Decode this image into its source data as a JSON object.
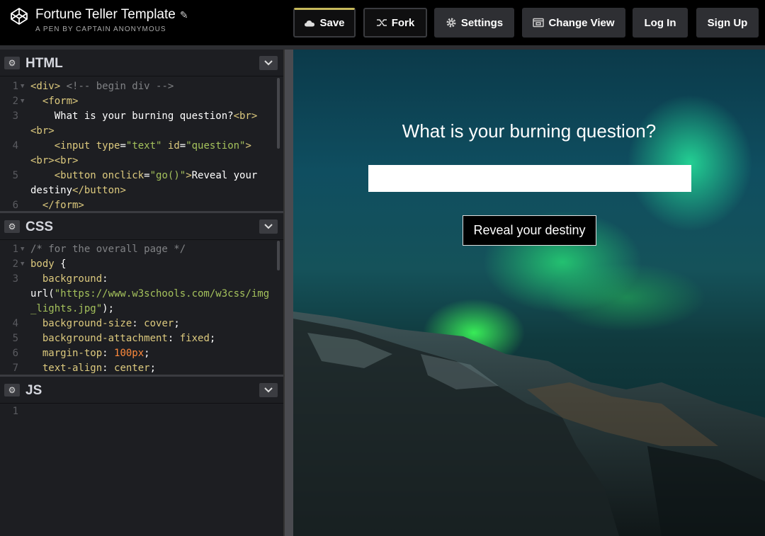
{
  "header": {
    "title": "Fortune Teller Template",
    "author": "A PEN BY CAPTAIN ANONYMOUS",
    "buttons": {
      "save": "Save",
      "fork": "Fork",
      "settings": "Settings",
      "change_view": "Change View",
      "login": "Log In",
      "signup": "Sign Up"
    },
    "accent": "#c6b85a"
  },
  "panels": {
    "html": {
      "title": "HTML"
    },
    "css": {
      "title": "CSS"
    },
    "js": {
      "title": "JS"
    }
  },
  "html_code": [
    {
      "n": "1",
      "fold": true,
      "parts": [
        [
          "t-tag",
          "<div>"
        ],
        [
          "t-cmt",
          " <!-- begin div -->"
        ]
      ]
    },
    {
      "n": "2",
      "fold": true,
      "parts": [
        [
          "t-txt",
          "  "
        ],
        [
          "t-tag",
          "<form>"
        ]
      ]
    },
    {
      "n": "3",
      "fold": false,
      "parts": [
        [
          "t-txt",
          "    What is your burning question?"
        ],
        [
          "t-tag",
          "<br>"
        ]
      ]
    },
    {
      "n": "",
      "fold": false,
      "parts": [
        [
          "t-tag",
          "<br>"
        ]
      ]
    },
    {
      "n": "4",
      "fold": false,
      "parts": [
        [
          "t-txt",
          "    "
        ],
        [
          "t-tag",
          "<input "
        ],
        [
          "t-attr",
          "type"
        ],
        [
          "t-txt",
          "="
        ],
        [
          "t-str",
          "\"text\""
        ],
        [
          "t-txt",
          " "
        ],
        [
          "t-attr",
          "id"
        ],
        [
          "t-txt",
          "="
        ],
        [
          "t-str",
          "\"question\""
        ],
        [
          "t-tag",
          ">"
        ]
      ]
    },
    {
      "n": "",
      "fold": false,
      "parts": [
        [
          "t-tag",
          "<br><br>"
        ]
      ]
    },
    {
      "n": "5",
      "fold": false,
      "parts": [
        [
          "t-txt",
          "    "
        ],
        [
          "t-tag",
          "<button "
        ],
        [
          "t-attr",
          "onclick"
        ],
        [
          "t-txt",
          "="
        ],
        [
          "t-str",
          "\"go()\""
        ],
        [
          "t-tag",
          ">"
        ],
        [
          "t-txt",
          "Reveal your"
        ]
      ]
    },
    {
      "n": "",
      "fold": false,
      "parts": [
        [
          "t-txt",
          "destiny"
        ],
        [
          "t-tag",
          "</button>"
        ]
      ]
    },
    {
      "n": "6",
      "fold": false,
      "parts": [
        [
          "t-txt",
          "  "
        ],
        [
          "t-tag",
          "</form>"
        ]
      ]
    }
  ],
  "css_code": [
    {
      "n": "1",
      "fold": true,
      "parts": [
        [
          "t-cmt",
          "/* for the overall page */"
        ]
      ]
    },
    {
      "n": "2",
      "fold": true,
      "parts": [
        [
          "t-tag",
          "body"
        ],
        [
          "t-txt",
          " {"
        ]
      ]
    },
    {
      "n": "3",
      "fold": false,
      "parts": [
        [
          "t-txt",
          "  "
        ],
        [
          "t-prop",
          "background"
        ],
        [
          "t-txt",
          ":"
        ]
      ]
    },
    {
      "n": "",
      "fold": false,
      "parts": [
        [
          "t-txt",
          "url("
        ],
        [
          "t-str",
          "\"https://www.w3schools.com/w3css/img"
        ]
      ]
    },
    {
      "n": "",
      "fold": false,
      "parts": [
        [
          "t-str",
          "_lights.jpg\""
        ],
        [
          "t-txt",
          ");"
        ]
      ]
    },
    {
      "n": "4",
      "fold": false,
      "parts": [
        [
          "t-txt",
          "  "
        ],
        [
          "t-prop",
          "background-size"
        ],
        [
          "t-txt",
          ": "
        ],
        [
          "t-prop",
          "cover"
        ],
        [
          "t-txt",
          ";"
        ]
      ]
    },
    {
      "n": "5",
      "fold": false,
      "parts": [
        [
          "t-txt",
          "  "
        ],
        [
          "t-prop",
          "background-attachment"
        ],
        [
          "t-txt",
          ": "
        ],
        [
          "t-prop",
          "fixed"
        ],
        [
          "t-txt",
          ";"
        ]
      ]
    },
    {
      "n": "6",
      "fold": false,
      "parts": [
        [
          "t-txt",
          "  "
        ],
        [
          "t-prop",
          "margin-top"
        ],
        [
          "t-txt",
          ": "
        ],
        [
          "t-num",
          "100px"
        ],
        [
          "t-txt",
          ";"
        ]
      ]
    },
    {
      "n": "7",
      "fold": false,
      "parts": [
        [
          "t-txt",
          "  "
        ],
        [
          "t-prop",
          "text-align"
        ],
        [
          "t-txt",
          ": "
        ],
        [
          "t-prop",
          "center"
        ],
        [
          "t-txt",
          ";"
        ]
      ]
    }
  ],
  "js_code": [
    {
      "n": "1",
      "fold": false,
      "parts": []
    }
  ],
  "preview": {
    "heading": "What is your burning question?",
    "input_value": "",
    "button_label": "Reveal your destiny"
  }
}
